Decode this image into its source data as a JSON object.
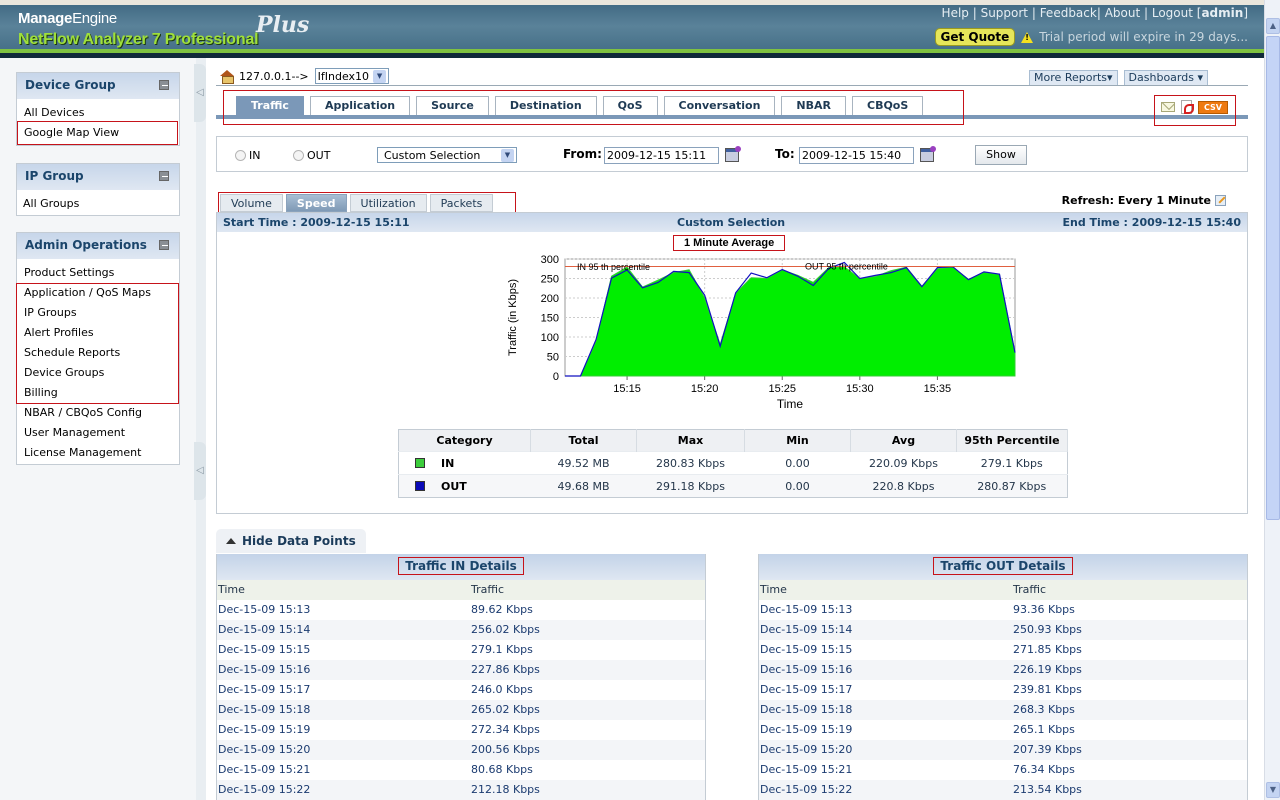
{
  "header": {
    "brand": "Manage",
    "brand_light": "Engine",
    "product": "NetFlow Analyzer 7 Professional",
    "edition": "Plus",
    "links": [
      "Help",
      "Support",
      "Feedback",
      "About",
      "Logout"
    ],
    "user": "admin",
    "get_quote": "Get Quote",
    "trial_notice": "Trial period will expire in 29 days..."
  },
  "sidebar": {
    "device_group": {
      "title": "Device Group",
      "items": [
        "All Devices",
        "Google Map View"
      ]
    },
    "ip_group": {
      "title": "IP Group",
      "items": [
        "All Groups"
      ]
    },
    "admin_ops": {
      "title": "Admin Operations",
      "items": [
        "Product Settings",
        "Application / QoS Maps",
        "IP Groups",
        "Alert Profiles",
        "Schedule Reports",
        "Device Groups",
        "Billing",
        "NBAR / CBQoS Config",
        "User Management",
        "License Management"
      ]
    }
  },
  "breadcrumb": {
    "device": "127.0.0.1-->",
    "interface": "IfIndex10"
  },
  "top_buttons": {
    "more_reports": "More Reports",
    "dashboards": "Dashboards"
  },
  "tabs": [
    "Traffic",
    "Application",
    "Source",
    "Destination",
    "QoS",
    "Conversation",
    "NBAR",
    "CBQoS"
  ],
  "active_tab": "Traffic",
  "export": {
    "csv": "CSV"
  },
  "filter": {
    "in_label": "IN",
    "out_label": "OUT",
    "period": "Custom Selection",
    "from_label": "From:",
    "from_value": "2009-12-15 15:11",
    "to_label": "To:",
    "to_value": "2009-12-15 15:40",
    "show": "Show"
  },
  "subtabs": [
    "Volume",
    "Speed",
    "Utilization",
    "Packets"
  ],
  "active_subtab": "Speed",
  "refresh": "Refresh: Every 1 Minute",
  "panel": {
    "start": "Start Time : 2009-12-15 15:11",
    "mode": "Custom Selection",
    "end": "End Time : 2009-12-15 15:40",
    "avg_label": "1 Minute Average"
  },
  "colors": {
    "in": "#00ee00",
    "out": "#1010c0",
    "percentile": "#e06040",
    "accent": "#7b98b8"
  },
  "chart_data": {
    "type": "area",
    "title": "1 Minute Average",
    "xlabel": "Time",
    "ylabel": "Traffic (in Kbps)",
    "ylim": [
      0,
      300
    ],
    "yticks": [
      0,
      50,
      100,
      150,
      200,
      250,
      300
    ],
    "xticks": [
      "15:15",
      "15:20",
      "15:25",
      "15:30",
      "15:35"
    ],
    "grid": true,
    "x": [
      "15:11",
      "15:12",
      "15:13",
      "15:14",
      "15:15",
      "15:16",
      "15:17",
      "15:18",
      "15:19",
      "15:20",
      "15:21",
      "15:22",
      "15:23",
      "15:24",
      "15:25",
      "15:26",
      "15:27",
      "15:28",
      "15:29",
      "15:30",
      "15:31",
      "15:32",
      "15:33",
      "15:34",
      "15:35",
      "15:36",
      "15:37",
      "15:38",
      "15:39",
      "15:40"
    ],
    "series": [
      {
        "name": "IN",
        "values": [
          0,
          0,
          89.62,
          256.02,
          279.1,
          227.86,
          246.0,
          265.02,
          272.34,
          200.56,
          80.68,
          212.18,
          252,
          250,
          272,
          258,
          240,
          278,
          280,
          250,
          255,
          270,
          279,
          230,
          275,
          279,
          248,
          266,
          260,
          60
        ]
      },
      {
        "name": "OUT",
        "values": [
          0,
          0,
          93.36,
          250.93,
          271.85,
          226.19,
          239.81,
          268.3,
          265.1,
          207.39,
          76.34,
          213.54,
          264,
          252,
          273,
          256,
          232,
          276,
          291,
          250,
          258,
          265,
          278,
          229,
          278,
          280,
          247,
          267,
          261,
          60
        ]
      }
    ],
    "annotations": [
      {
        "text": "IN 95 th percentile",
        "value": 279.1
      },
      {
        "text": "OUT 95 th percentile",
        "value": 280.87
      }
    ]
  },
  "stats": {
    "headers": [
      "Category",
      "Total",
      "Max",
      "Min",
      "Avg",
      "95th Percentile"
    ],
    "rows": [
      {
        "category": "IN",
        "total": "49.52 MB",
        "max": "280.83 Kbps",
        "min": "0.00",
        "avg": "220.09 Kbps",
        "p95": "279.1 Kbps"
      },
      {
        "category": "OUT",
        "total": "49.68 MB",
        "max": "291.18 Kbps",
        "min": "0.00",
        "avg": "220.8 Kbps",
        "p95": "280.87 Kbps"
      }
    ]
  },
  "hide_data_points": "Hide Data Points",
  "details_in": {
    "title": "Traffic IN Details",
    "headers": [
      "Time",
      "Traffic"
    ],
    "rows": [
      [
        "Dec-15-09 15:13",
        "89.62 Kbps"
      ],
      [
        "Dec-15-09 15:14",
        "256.02 Kbps"
      ],
      [
        "Dec-15-09 15:15",
        "279.1 Kbps"
      ],
      [
        "Dec-15-09 15:16",
        "227.86 Kbps"
      ],
      [
        "Dec-15-09 15:17",
        "246.0 Kbps"
      ],
      [
        "Dec-15-09 15:18",
        "265.02 Kbps"
      ],
      [
        "Dec-15-09 15:19",
        "272.34 Kbps"
      ],
      [
        "Dec-15-09 15:20",
        "200.56 Kbps"
      ],
      [
        "Dec-15-09 15:21",
        "80.68 Kbps"
      ],
      [
        "Dec-15-09 15:22",
        "212.18 Kbps"
      ]
    ]
  },
  "details_out": {
    "title": "Traffic OUT Details",
    "headers": [
      "Time",
      "Traffic"
    ],
    "rows": [
      [
        "Dec-15-09 15:13",
        "93.36 Kbps"
      ],
      [
        "Dec-15-09 15:14",
        "250.93 Kbps"
      ],
      [
        "Dec-15-09 15:15",
        "271.85 Kbps"
      ],
      [
        "Dec-15-09 15:16",
        "226.19 Kbps"
      ],
      [
        "Dec-15-09 15:17",
        "239.81 Kbps"
      ],
      [
        "Dec-15-09 15:18",
        "268.3 Kbps"
      ],
      [
        "Dec-15-09 15:19",
        "265.1 Kbps"
      ],
      [
        "Dec-15-09 15:20",
        "207.39 Kbps"
      ],
      [
        "Dec-15-09 15:21",
        "76.34 Kbps"
      ],
      [
        "Dec-15-09 15:22",
        "213.54 Kbps"
      ]
    ]
  }
}
